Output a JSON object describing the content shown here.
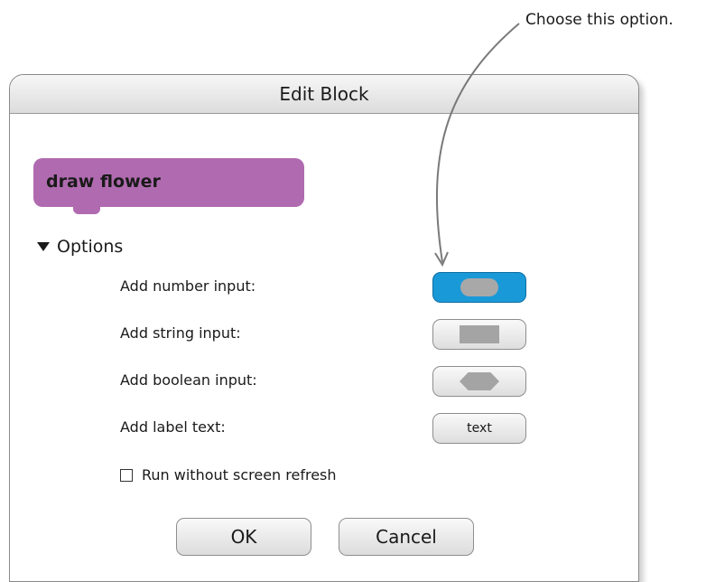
{
  "annotation": {
    "text": "Choose this option."
  },
  "dialog": {
    "title": "Edit Block",
    "block_label": "draw flower",
    "options_header": "Options",
    "options": [
      {
        "label": "Add number input:",
        "shape": "oval",
        "selected": true
      },
      {
        "label": "Add string input:",
        "shape": "rect",
        "selected": false
      },
      {
        "label": "Add boolean input:",
        "shape": "hexagon",
        "selected": false
      },
      {
        "label": "Add label text:",
        "shape": "text",
        "button_text": "text",
        "selected": false
      }
    ],
    "run_without_refresh": {
      "label": "Run without screen refresh",
      "checked": false
    },
    "ok_label": "OK",
    "cancel_label": "Cancel"
  },
  "colors": {
    "block": "#b06bb0",
    "selected_button": "#1a99d8"
  }
}
